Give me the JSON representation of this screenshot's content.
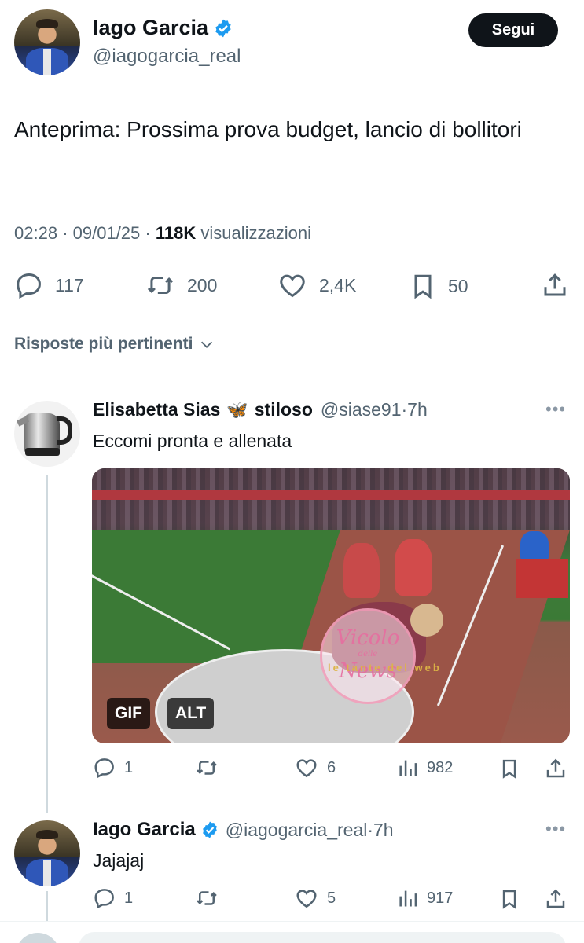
{
  "tweet": {
    "author_name": "Iago Garcia",
    "author_handle": "@iagogarcia_real",
    "follow_label": "Segui",
    "text": "Anteprima: Prossima prova budget, lancio di bollitori",
    "time": "02:28",
    "date": "09/01/25",
    "sep": "·",
    "views_count": "118K",
    "views_label": "visualizzazioni",
    "stats": {
      "replies": "117",
      "reposts": "200",
      "likes": "2,4K",
      "bookmarks": "50"
    }
  },
  "replies_filter": "Risposte più pertinenti",
  "replies": [
    {
      "author_name": "Elisabetta Sias",
      "author_emoji": "🦋",
      "author_suffix": "stiloso",
      "author_handle": "@siase91",
      "age": "·7h",
      "text": "Eccomi pronta e allenata",
      "media_badges": [
        "GIF",
        "ALT"
      ],
      "watermark": {
        "main": "Vicolo",
        "sub": "delle",
        "tail": "News",
        "side": "le tante del web"
      },
      "stats": {
        "replies": "1",
        "reposts": "",
        "likes": "6",
        "views": "982"
      }
    },
    {
      "author_name": "Iago Garcia",
      "author_handle": "@iagogarcia_real",
      "age": "·7h",
      "text": "Jajajaj",
      "stats": {
        "replies": "1",
        "reposts": "",
        "likes": "5",
        "views": "917"
      }
    }
  ],
  "icons": {
    "verified": "verified-badge-icon",
    "reply": "reply-icon",
    "repost": "repost-icon",
    "like": "heart-icon",
    "bookmark": "bookmark-icon",
    "share": "share-icon",
    "views": "views-icon",
    "more": "more-icon"
  },
  "colors": {
    "verified": "#1d9bf0",
    "text": "#0f1419",
    "muted": "#536471"
  }
}
